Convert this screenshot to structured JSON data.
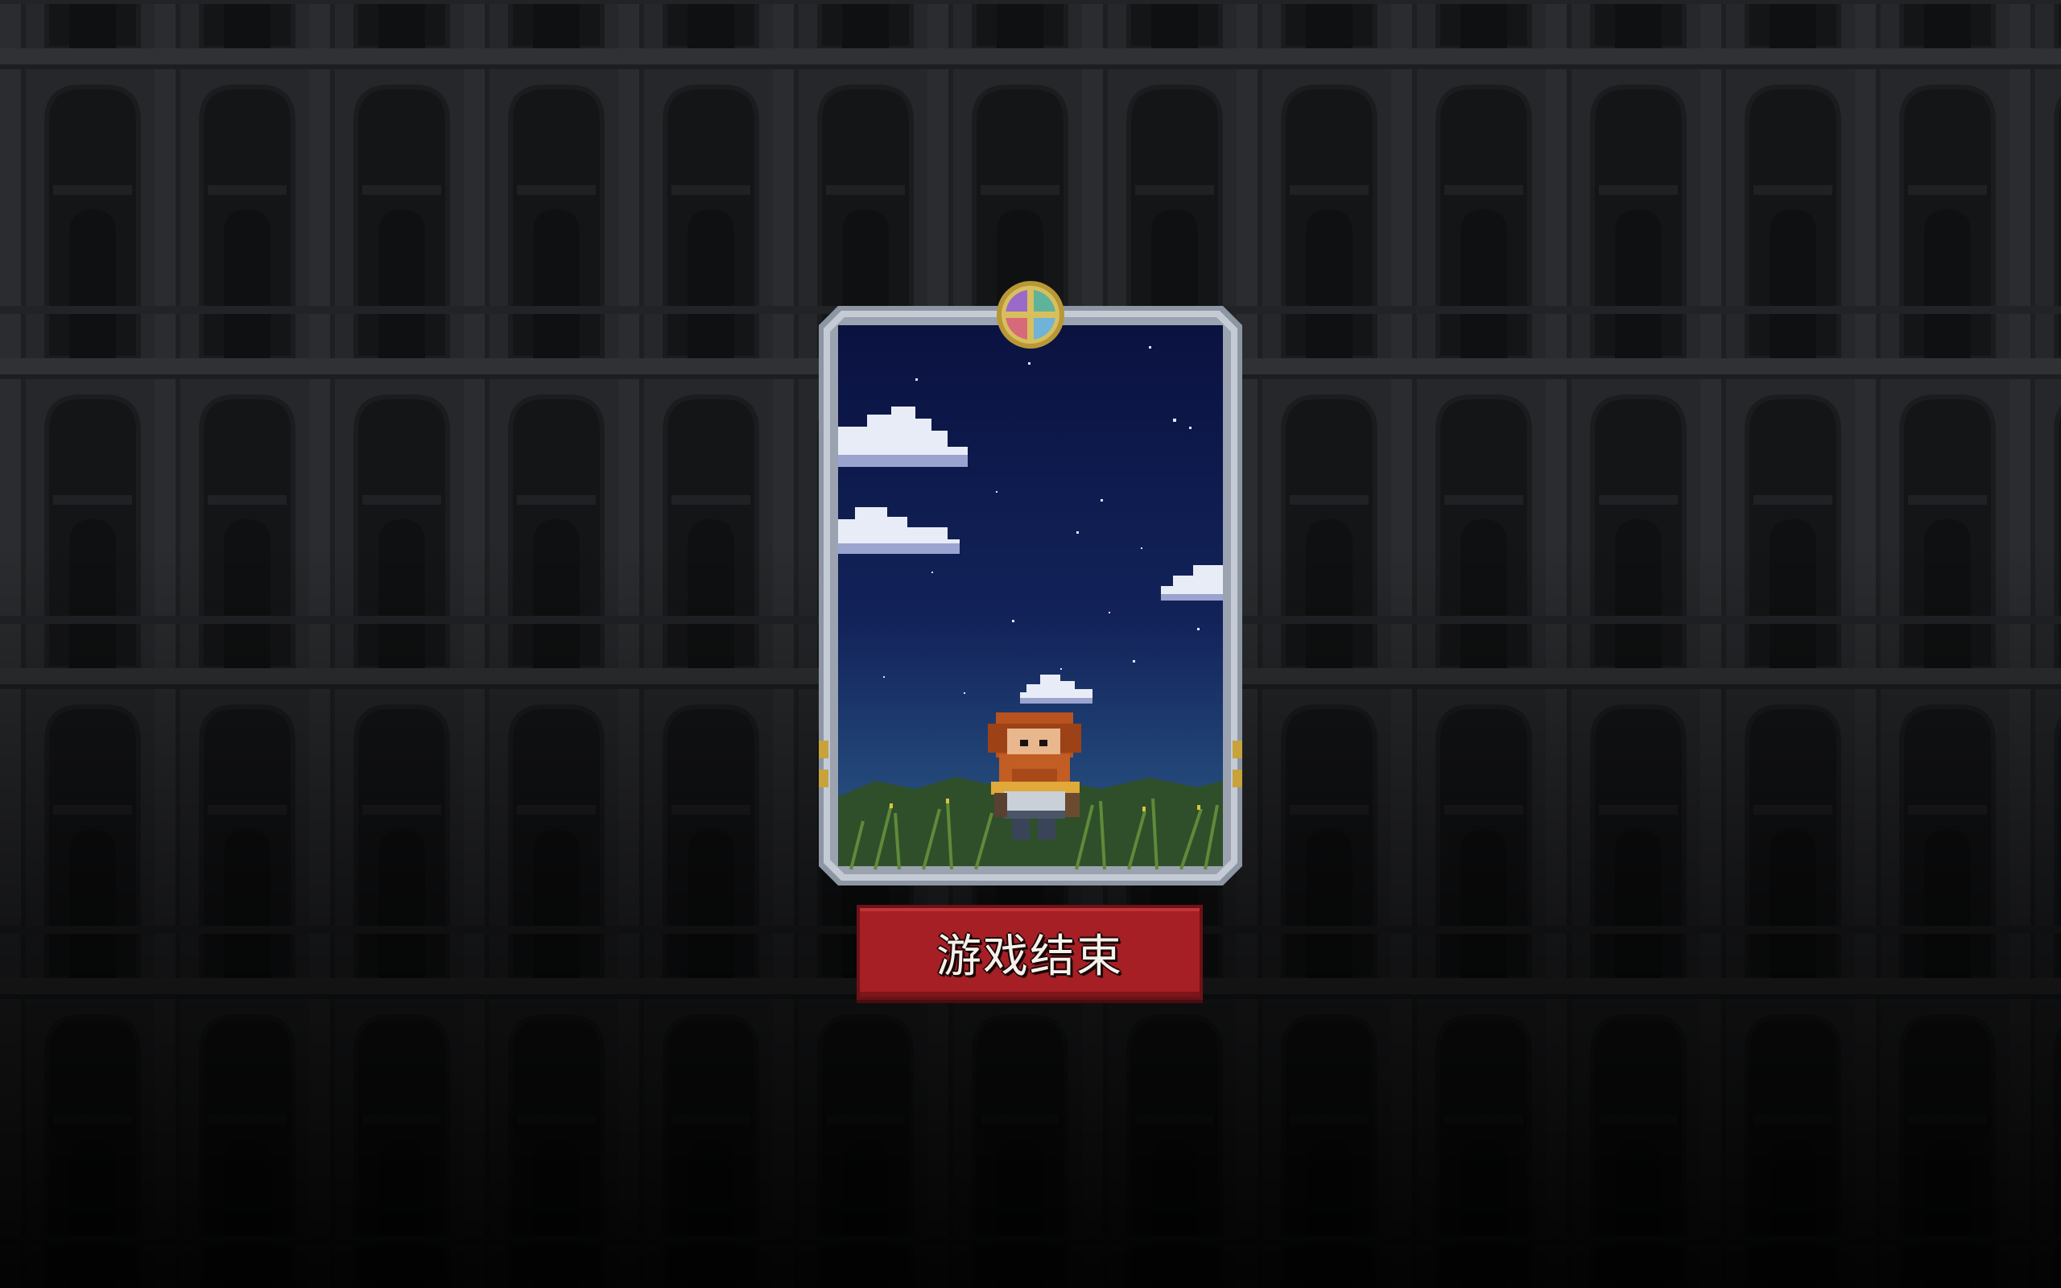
{
  "game": {
    "screen": "game-over",
    "button_label": "游戏结束"
  },
  "portrait": {
    "character": "red-bearded-warrior",
    "scene": "night-sky-with-clouds-and-grass",
    "medallion_icon": "four-color-emblem-icon"
  },
  "colors": {
    "button_fill": "#a51f25",
    "button_border": "#6e1216",
    "card_frame": "#aeb6c2",
    "sky_top": "#0a1240",
    "sky_bottom": "#2c5a8a",
    "background": "#202123"
  }
}
